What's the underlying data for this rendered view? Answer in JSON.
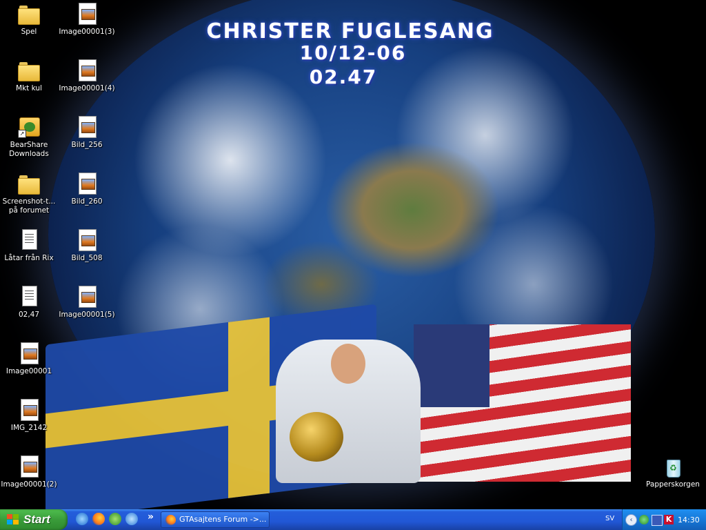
{
  "wallpaper": {
    "headline_name": "CHRISTER FUGLESANG",
    "headline_date": "10/12-06",
    "headline_time": "02.47"
  },
  "desktop_icons": {
    "col1": [
      {
        "label": "Spel",
        "icon": "folder-icon"
      },
      {
        "label": "Mkt kul",
        "icon": "folder-icon"
      },
      {
        "label": "BearShare Downloads",
        "icon": "bearshare-icon"
      },
      {
        "label": "Screenshot-t... på forumet",
        "icon": "folder-icon"
      },
      {
        "label": "Låtar från Rix",
        "icon": "text-file-icon"
      },
      {
        "label": "02,47",
        "icon": "text-file-icon"
      },
      {
        "label": "Image00001",
        "icon": "image-file-icon"
      },
      {
        "label": "IMG_2142",
        "icon": "image-file-icon"
      },
      {
        "label": "Image00001(2)",
        "icon": "image-file-icon"
      }
    ],
    "col2": [
      {
        "label": "Image00001(3)",
        "icon": "image-file-icon"
      },
      {
        "label": "Image00001(4)",
        "icon": "image-file-icon"
      },
      {
        "label": "Bild_256",
        "icon": "image-file-icon"
      },
      {
        "label": "Bild_260",
        "icon": "image-file-icon"
      },
      {
        "label": "Bild_508",
        "icon": "image-file-icon"
      },
      {
        "label": "Image00001(5)",
        "icon": "image-file-icon"
      }
    ],
    "recycle_bin": {
      "label": "Papperskorgen",
      "icon": "recycle-bin-icon"
    }
  },
  "taskbar": {
    "start_label": "Start",
    "quick_launch": [
      "internet-explorer-icon",
      "firefox-icon",
      "messenger-icon",
      "ie-icon"
    ],
    "overflow": "»",
    "tasks": [
      {
        "label": "GTAsajtens Forum ->...",
        "icon": "firefox-icon"
      }
    ],
    "language": "SV",
    "tray_icons": [
      "show-hidden-icon",
      "network-icon",
      "monitor-icon",
      "kaspersky-icon"
    ],
    "clock": "14:30"
  },
  "colors": {
    "taskbar_blue": "#245edb",
    "start_green": "#3a9c3a",
    "tray_blue": "#1778d8"
  }
}
